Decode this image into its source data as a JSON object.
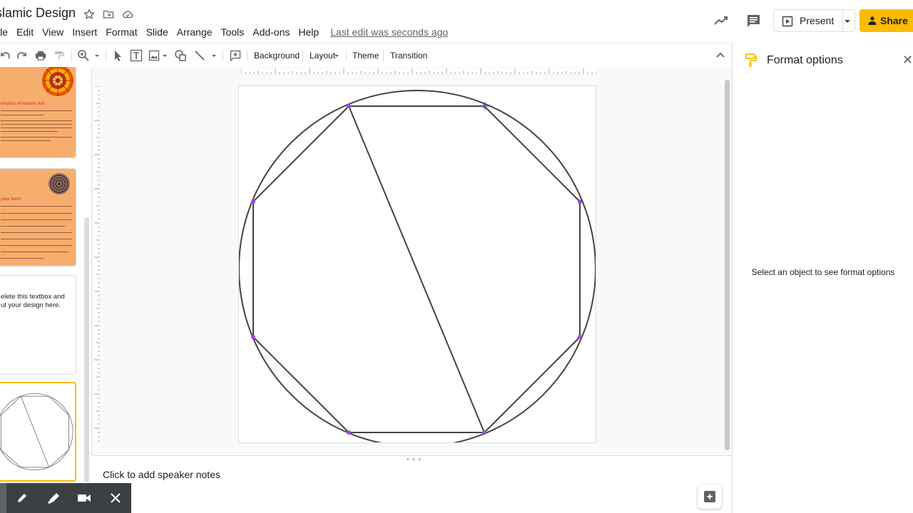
{
  "document": {
    "title": "slamic Design"
  },
  "menu": {
    "items": [
      "File",
      "Edit",
      "View",
      "Insert",
      "Format",
      "Slide",
      "Arrange",
      "Tools",
      "Add-ons",
      "Help"
    ],
    "first_visible": "ile",
    "last_edit": "Last edit was seconds ago"
  },
  "header": {
    "present_label": "Present",
    "share_label": "Share"
  },
  "toolbar": {
    "background_label": "Background",
    "layout_label": "Layout",
    "theme_label": "Theme",
    "transition_label": "Transition"
  },
  "filmstrip": {
    "slide_a_heading": "eristics of Islamic Art:",
    "slide_b_heading": "your turn!",
    "slide_c_text_1": "elete this textbox and",
    "slide_c_text_2": "ut your design here."
  },
  "notes": {
    "placeholder": "Click to add speaker notes"
  },
  "format_panel": {
    "title": "Format options",
    "message": "Select an object to see format options"
  },
  "colors": {
    "accent_yellow": "#fbbc04",
    "vertex_purple": "#a142f4",
    "thumb_orange": "#f6ae6e",
    "thumb_red": "#e8463a"
  }
}
